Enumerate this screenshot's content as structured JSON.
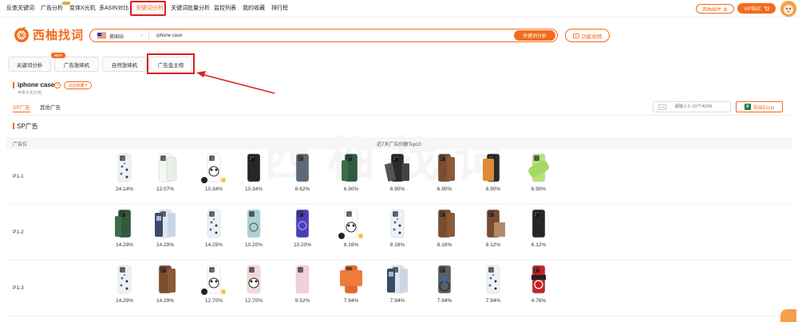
{
  "nav": {
    "items": [
      "反查关键词",
      "广告分析",
      "变体X光机",
      "多ASIN对比",
      "关键词分析",
      "关键词批量分析",
      "监控列表",
      "我的收藏",
      "排行榜"
    ],
    "active_index": 4,
    "plugin_label": "西柚插件",
    "vip_label": "VIP购买"
  },
  "logo": {
    "text": "西柚找词"
  },
  "search": {
    "site": "美国站",
    "value": "iphone case",
    "button": "关键词分析"
  },
  "video_button": "功能视频",
  "tabs": [
    "关键词分析",
    "广告放映机",
    "自然放映机",
    "广告金主榜"
  ],
  "hot_badge": "HOT",
  "active_tab": 3,
  "keyword": {
    "title": "iphone case",
    "favorite_label": "添加收藏",
    "subtitle": "苹果手机外壳"
  },
  "subtabs": [
    "SP广告",
    "其他广告"
  ],
  "asin_placeholder": "请输入1~10个ASIN",
  "export_label": "导出Excel",
  "section_title": "SP广告",
  "table": {
    "col_position": "广告位",
    "col_top": "近7天广告份额Top10",
    "rows": [
      {
        "label": "P1-1",
        "cells": [
          {
            "pct": "24.14%",
            "style": "pattern"
          },
          {
            "pct": "12.07%",
            "style": "clear"
          },
          {
            "pct": "10.34%",
            "style": "panda"
          },
          {
            "pct": "10.34%",
            "style": "black"
          },
          {
            "pct": "8.62%",
            "style": "slate"
          },
          {
            "pct": "6.90%",
            "style": "green"
          },
          {
            "pct": "6.90%",
            "style": "black-stand"
          },
          {
            "pct": "6.90%",
            "style": "brown"
          },
          {
            "pct": "6.90%",
            "style": "orange-stand"
          },
          {
            "pct": "6.90%",
            "style": "lime"
          }
        ]
      },
      {
        "label": "P1-2",
        "cells": [
          {
            "pct": "14.29%",
            "style": "green"
          },
          {
            "pct": "14.29%",
            "style": "photo"
          },
          {
            "pct": "14.29%",
            "style": "pattern"
          },
          {
            "pct": "10.20%",
            "style": "teal-ring"
          },
          {
            "pct": "10.20%",
            "style": "purple"
          },
          {
            "pct": "8.16%",
            "style": "panda"
          },
          {
            "pct": "8.16%",
            "style": "pattern"
          },
          {
            "pct": "8.16%",
            "style": "brown"
          },
          {
            "pct": "6.12%",
            "style": "brown-wallet"
          },
          {
            "pct": "6.12%",
            "style": "black"
          }
        ]
      },
      {
        "label": "P1-3",
        "cells": [
          {
            "pct": "14.29%",
            "style": "pattern"
          },
          {
            "pct": "14.29%",
            "style": "brown"
          },
          {
            "pct": "12.70%",
            "style": "panda"
          },
          {
            "pct": "12.70%",
            "style": "pink-panda"
          },
          {
            "pct": "9.52%",
            "style": "pink"
          },
          {
            "pct": "7.94%",
            "style": "orange-wallet"
          },
          {
            "pct": "7.94%",
            "style": "photo"
          },
          {
            "pct": "7.94%",
            "style": "ring-stand"
          },
          {
            "pct": "7.94%",
            "style": "pattern"
          },
          {
            "pct": "4.76%",
            "style": "red-ring"
          }
        ]
      }
    ]
  },
  "colors": {
    "accent": "#f26b1d",
    "highlight_box": "#d81e1e"
  }
}
